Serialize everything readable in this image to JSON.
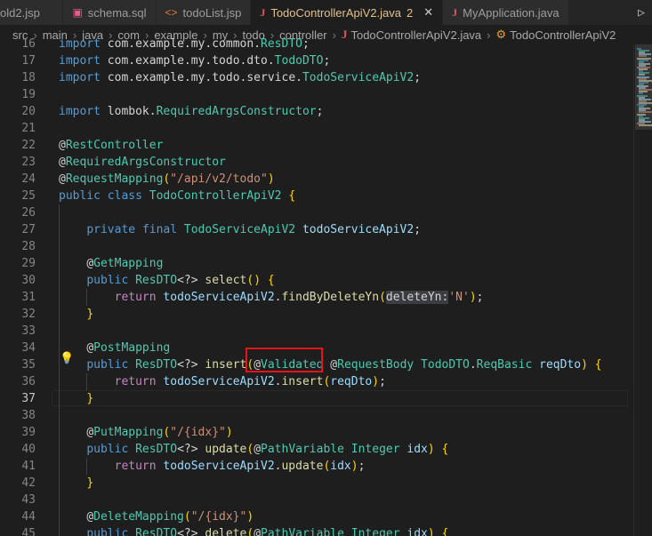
{
  "tabs": [
    {
      "label": "old2.jsp",
      "icon": "jsp-icon",
      "active": false
    },
    {
      "label": "schema.sql",
      "icon": "database-icon",
      "active": false
    },
    {
      "label": "todoList.jsp",
      "icon": "jsp-brackets-icon",
      "active": false
    },
    {
      "label": "TodoControllerApiV2.java",
      "icon": "java-icon",
      "active": true,
      "badge": "2"
    },
    {
      "label": "MyApplication.java",
      "icon": "java-icon",
      "active": false
    }
  ],
  "breadcrumb": [
    "src",
    "main",
    "java",
    "com",
    "example",
    "my",
    "todo",
    "controller",
    "TodoControllerApiV2.java",
    "TodoControllerApiV2"
  ],
  "lines": [
    {
      "n": "16",
      "text": "import com.example.my.common.ResDTO;"
    },
    {
      "n": "17",
      "text": "import com.example.my.todo.dto.TodoDTO;"
    },
    {
      "n": "18",
      "text": "import com.example.my.todo.service.TodoServiceApiV2;"
    },
    {
      "n": "19",
      "text": ""
    },
    {
      "n": "20",
      "text": "import lombok.RequiredArgsConstructor;"
    },
    {
      "n": "21",
      "text": ""
    },
    {
      "n": "22",
      "text": "@RestController"
    },
    {
      "n": "23",
      "text": "@RequiredArgsConstructor"
    },
    {
      "n": "24",
      "text": "@RequestMapping(\"/api/v2/todo\")"
    },
    {
      "n": "25",
      "text": "public class TodoControllerApiV2 {"
    },
    {
      "n": "26",
      "text": ""
    },
    {
      "n": "27",
      "text": "    private final TodoServiceApiV2 todoServiceApiV2;"
    },
    {
      "n": "28",
      "text": ""
    },
    {
      "n": "29",
      "text": "    @GetMapping"
    },
    {
      "n": "30",
      "text": "    public ResDTO<?> select() {"
    },
    {
      "n": "31",
      "text": "        return todoServiceApiV2.findByDeleteYn(deleteYn:'N');"
    },
    {
      "n": "32",
      "text": "    }"
    },
    {
      "n": "33",
      "text": ""
    },
    {
      "n": "34",
      "text": "    @PostMapping"
    },
    {
      "n": "35",
      "text": "    public ResDTO<?> insert(@Validated @RequestBody TodoDTO.ReqBasic reqDto) {"
    },
    {
      "n": "36",
      "text": "        return todoServiceApiV2.insert(reqDto);"
    },
    {
      "n": "37",
      "text": "    }"
    },
    {
      "n": "38",
      "text": ""
    },
    {
      "n": "39",
      "text": "    @PutMapping(\"/{idx}\")"
    },
    {
      "n": "40",
      "text": "    public ResDTO<?> update(@PathVariable Integer idx) {"
    },
    {
      "n": "41",
      "text": "        return todoServiceApiV2.update(idx);"
    },
    {
      "n": "42",
      "text": "    }"
    },
    {
      "n": "43",
      "text": ""
    },
    {
      "n": "44",
      "text": "    @DeleteMapping(\"/{idx}\")"
    },
    {
      "n": "45",
      "text": "    public ResDTO<?> delete(@PathVariable Integer idx) {"
    }
  ],
  "current_line": "37",
  "highlight_color": "#e8141c"
}
